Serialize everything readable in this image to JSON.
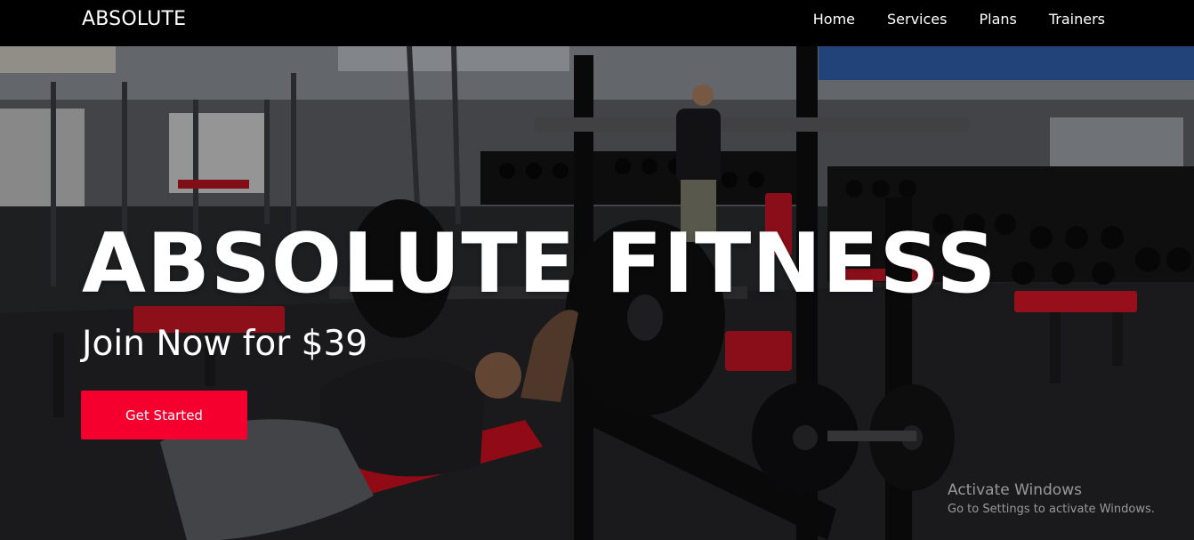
{
  "nav": {
    "brand": "ABSOLUTE",
    "links": [
      "Home",
      "Services",
      "Plans",
      "Trainers"
    ]
  },
  "hero": {
    "title": "ABSOLUTE FITNESS",
    "subtitle": "Join Now for $39",
    "cta_label": "Get Started",
    "background": "gym-interior-photo"
  },
  "watermark": {
    "title": "Activate Windows",
    "subtitle": "Go to Settings to activate Windows."
  },
  "colors": {
    "navbar_bg": "#000000",
    "accent": "#f5002e",
    "text": "#ffffff"
  }
}
